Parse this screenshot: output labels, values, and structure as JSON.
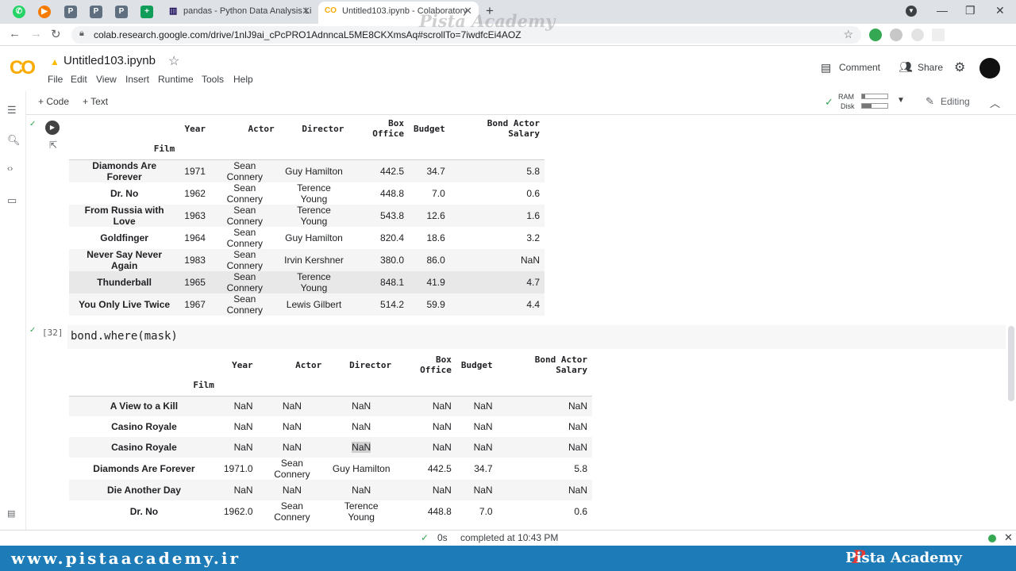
{
  "browser": {
    "tabs": [
      {
        "title": "pandas - Python Data Analysis Li"
      },
      {
        "title": "Untitled103.ipynb - Colaboratory"
      }
    ],
    "url": "colab.research.google.com/drive/1nlJ9ai_cPcPRO1AdnncaL5ME8CKXmsAq#scrollTo=7iwdfcEi4AOZ"
  },
  "colab": {
    "notebook_title": "Untitled103.ipynb",
    "menu": [
      "File",
      "Edit",
      "View",
      "Insert",
      "Runtime",
      "Tools",
      "Help"
    ],
    "comment_label": "Comment",
    "share_label": "Share",
    "add_code_label": "+ Code",
    "add_text_label": "+ Text",
    "ram_label": "RAM",
    "disk_label": "Disk",
    "editing_label": "Editing"
  },
  "output1": {
    "index_name": "Film",
    "columns": [
      "Year",
      "Actor",
      "Director",
      "Box Office",
      "Budget",
      "Bond Actor Salary"
    ],
    "rows": [
      {
        "film": "Diamonds Are Forever",
        "cells": [
          "1971",
          "Sean Connery",
          "Guy Hamilton",
          "442.5",
          "34.7",
          "5.8"
        ]
      },
      {
        "film": "Dr. No",
        "cells": [
          "1962",
          "Sean Connery",
          "Terence Young",
          "448.8",
          "7.0",
          "0.6"
        ]
      },
      {
        "film": "From Russia with Love",
        "cells": [
          "1963",
          "Sean Connery",
          "Terence Young",
          "543.8",
          "12.6",
          "1.6"
        ]
      },
      {
        "film": "Goldfinger",
        "cells": [
          "1964",
          "Sean Connery",
          "Guy Hamilton",
          "820.4",
          "18.6",
          "3.2"
        ]
      },
      {
        "film": "Never Say Never Again",
        "cells": [
          "1983",
          "Sean Connery",
          "Irvin Kershner",
          "380.0",
          "86.0",
          "NaN"
        ]
      },
      {
        "film": "Thunderball",
        "cells": [
          "1965",
          "Sean Connery",
          "Terence Young",
          "848.1",
          "41.9",
          "4.7"
        ]
      },
      {
        "film": "You Only Live Twice",
        "cells": [
          "1967",
          "Sean Connery",
          "Lewis Gilbert",
          "514.2",
          "59.9",
          "4.4"
        ]
      }
    ]
  },
  "cell32": {
    "prompt": "[32]",
    "code": "bond.where(mask)"
  },
  "output2": {
    "index_name": "Film",
    "columns": [
      "Year",
      "Actor",
      "Director",
      "Box Office",
      "Budget",
      "Bond Actor Salary"
    ],
    "rows": [
      {
        "film": "A View to a Kill",
        "cells": [
          "NaN",
          "NaN",
          "NaN",
          "NaN",
          "NaN",
          "NaN"
        ]
      },
      {
        "film": "Casino Royale",
        "cells": [
          "NaN",
          "NaN",
          "NaN",
          "NaN",
          "NaN",
          "NaN"
        ]
      },
      {
        "film": "Casino Royale",
        "cells": [
          "NaN",
          "NaN",
          "NaN",
          "NaN",
          "NaN",
          "NaN"
        ]
      },
      {
        "film": "Diamonds Are Forever",
        "cells": [
          "1971.0",
          "Sean Connery",
          "Guy Hamilton",
          "442.5",
          "34.7",
          "5.8"
        ]
      },
      {
        "film": "Die Another Day",
        "cells": [
          "NaN",
          "NaN",
          "NaN",
          "NaN",
          "NaN",
          "NaN"
        ]
      },
      {
        "film": "Dr. No",
        "cells": [
          "1962.0",
          "Sean Connery",
          "Terence Young",
          "448.8",
          "7.0",
          "0.6"
        ]
      }
    ]
  },
  "status": {
    "duration": "0s",
    "message": "completed at 10:43 PM"
  },
  "watermark": {
    "banner_url": "www.pistaacademy.ir",
    "brand": "Pista Academy",
    "overlay": "Pista Academy"
  }
}
